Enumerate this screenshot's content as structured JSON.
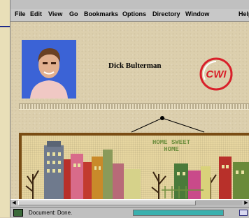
{
  "menu": {
    "file": "File",
    "edit": "Edit",
    "view": "View",
    "go": "Go",
    "bookmarks": "Bookmarks",
    "options": "Options",
    "directory": "Directory",
    "window": "Window",
    "help": "Help"
  },
  "page": {
    "person_name": "Dick Bulterman",
    "logo_text": "CWI",
    "sampler_text": "HOME SWEET HOME"
  },
  "status": {
    "text": "Document: Done."
  },
  "icons": {
    "status": "netscape-status-icon",
    "mail": "mail-icon"
  },
  "colors": {
    "menubar": "#c8c8c8",
    "content_bg": "#dccfad",
    "frame": "#7a4d14",
    "progress": "#3ab0ae",
    "cwi_red": "#d8202a"
  }
}
